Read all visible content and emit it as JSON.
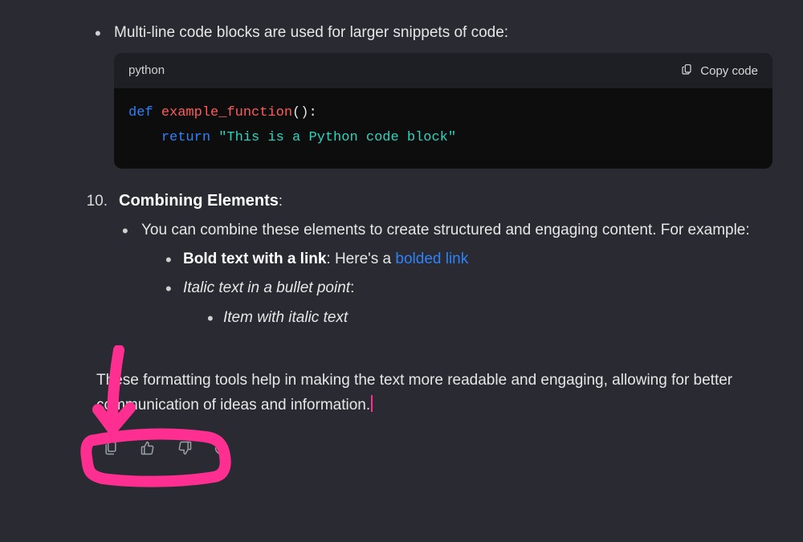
{
  "intro_bullet": "Multi-line code blocks are used for larger snippets of code:",
  "codeblock": {
    "language": "python",
    "copy_label": "Copy code",
    "code": {
      "kw_def": "def",
      "fn_name": "example_function",
      "parens_colon": "():",
      "kw_return": "return",
      "string_lit": "\"This is a Python code block\""
    }
  },
  "list10": {
    "number": "10.",
    "heading": "Combining Elements",
    "colon": ":",
    "bullet1": "You can combine these elements to create structured and engaging content. For example:",
    "sub1": {
      "bold_part": "Bold text with a link",
      "after_bold": ": Here's a ",
      "link_text": "bolded link"
    },
    "sub2": {
      "italic_part": "Italic text in a bullet point",
      "colon": ":"
    },
    "subsub1": "Item with italic text"
  },
  "outro": "These formatting tools help in making the text more readable and engaging, allowing for better communication of ideas and information.",
  "actions": {
    "copy": "copy",
    "thumbs_up": "thumbs-up",
    "thumbs_down": "thumbs-down",
    "regenerate": "regenerate"
  },
  "annotation_color": "#ff2f92"
}
